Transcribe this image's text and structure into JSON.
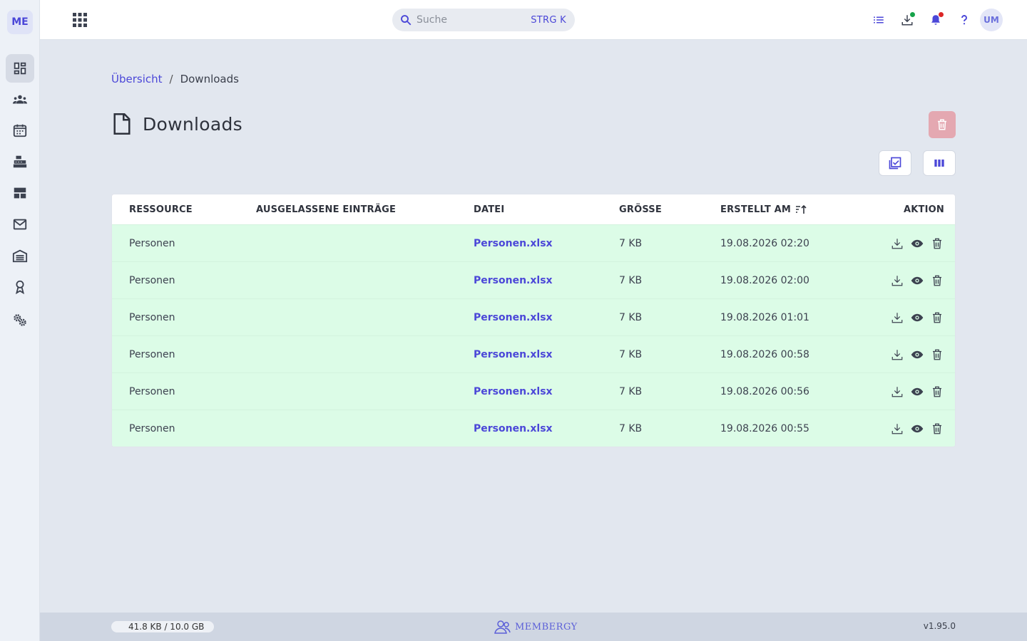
{
  "sidebar": {
    "logo": "ME",
    "items": [
      {
        "icon": "dashboard-icon",
        "active": true
      },
      {
        "icon": "people-icon"
      },
      {
        "icon": "calendar-icon"
      },
      {
        "icon": "cash-register-icon"
      },
      {
        "icon": "layout-icon"
      },
      {
        "icon": "mail-icon"
      },
      {
        "icon": "warehouse-icon"
      },
      {
        "icon": "award-icon"
      },
      {
        "icon": "settings-icon"
      }
    ]
  },
  "topbar": {
    "search_placeholder": "Suche",
    "search_shortcut": "STRG K",
    "avatar_initials": "UM",
    "icons": [
      "list-icon",
      "download-tray-icon",
      "bell-icon",
      "help-icon"
    ],
    "indicator_colors": {
      "download": "#16a34a",
      "bell": "#dc2626"
    }
  },
  "breadcrumb": {
    "parent": "Übersicht",
    "separator": "/",
    "current": "Downloads"
  },
  "page": {
    "title": "Downloads"
  },
  "table": {
    "headers": {
      "resource": "RESSOURCE",
      "skipped": "AUSGELASSENE EINTRÄGE",
      "file": "DATEI",
      "size": "GRÖSSE",
      "created": "ERSTELLT AM",
      "action": "AKTION"
    },
    "rows": [
      {
        "resource": "Personen",
        "skipped": "",
        "file": "Personen.xlsx",
        "size": "7 KB",
        "created": "19.08.2026 02:20"
      },
      {
        "resource": "Personen",
        "skipped": "",
        "file": "Personen.xlsx",
        "size": "7 KB",
        "created": "19.08.2026 02:00"
      },
      {
        "resource": "Personen",
        "skipped": "",
        "file": "Personen.xlsx",
        "size": "7 KB",
        "created": "19.08.2026 01:01"
      },
      {
        "resource": "Personen",
        "skipped": "",
        "file": "Personen.xlsx",
        "size": "7 KB",
        "created": "19.08.2026 00:58"
      },
      {
        "resource": "Personen",
        "skipped": "",
        "file": "Personen.xlsx",
        "size": "7 KB",
        "created": "19.08.2026 00:56"
      },
      {
        "resource": "Personen",
        "skipped": "",
        "file": "Personen.xlsx",
        "size": "7 KB",
        "created": "19.08.2026 00:55"
      }
    ]
  },
  "footer": {
    "storage": "41.8 KB / 10.0 GB",
    "brand": "MEMBERGY",
    "version": "v1.95.0"
  },
  "colors": {
    "accent": "#4b47d8",
    "row_success": "#dcfce7",
    "danger_disabled": "#e4a8b1"
  }
}
